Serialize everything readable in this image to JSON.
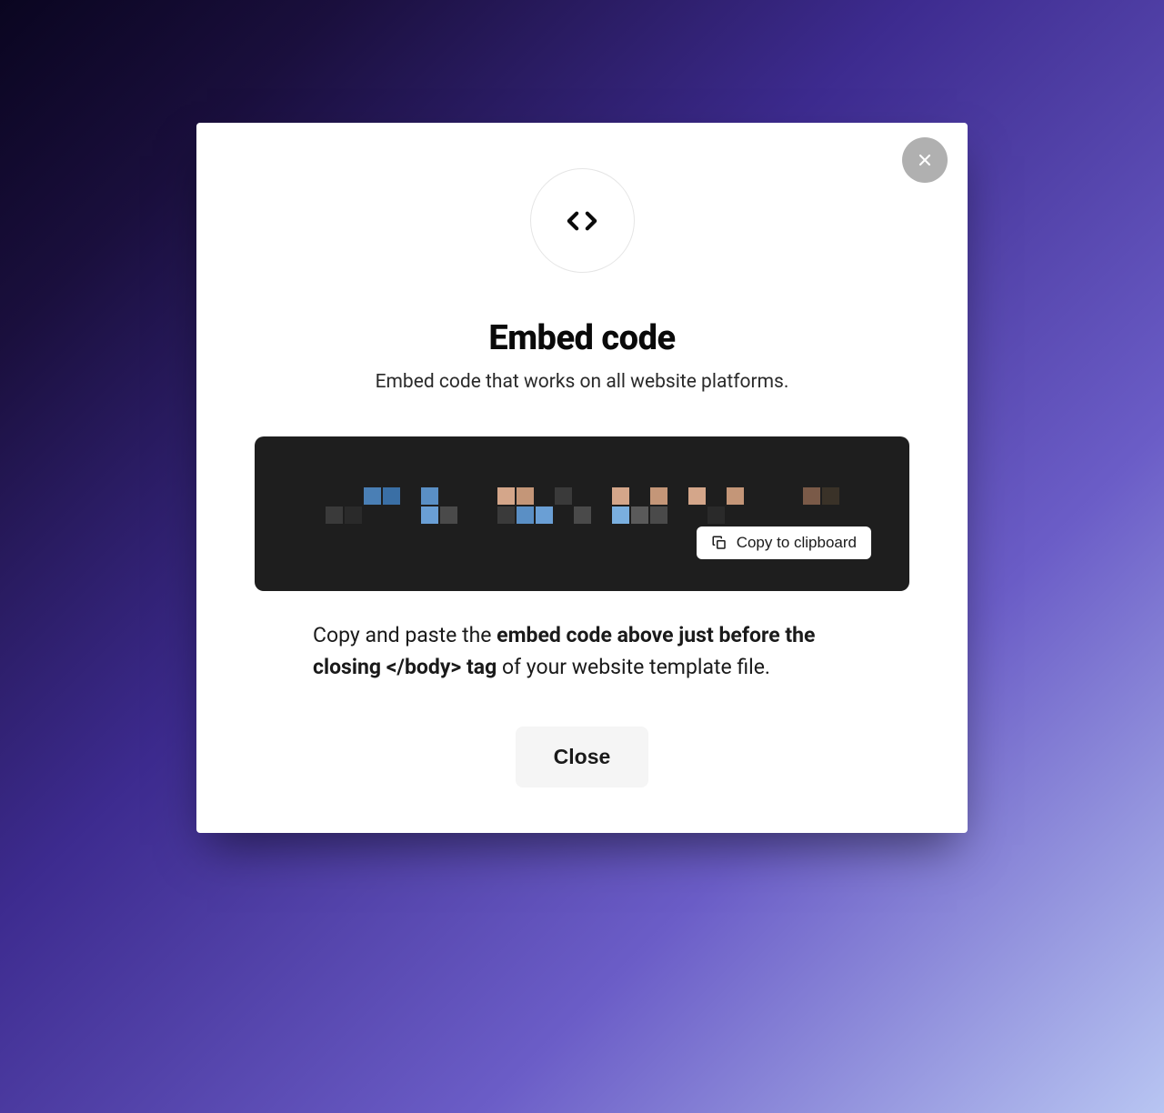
{
  "modal": {
    "title": "Embed code",
    "subtitle": "Embed code that works on all website platforms.",
    "copy_button_label": "Copy to clipboard",
    "instruction_prefix": "Copy and paste the ",
    "instruction_bold": "embed code above just before the closing </body> tag",
    "instruction_suffix": " of your website template file.",
    "close_button_label": "Close"
  }
}
